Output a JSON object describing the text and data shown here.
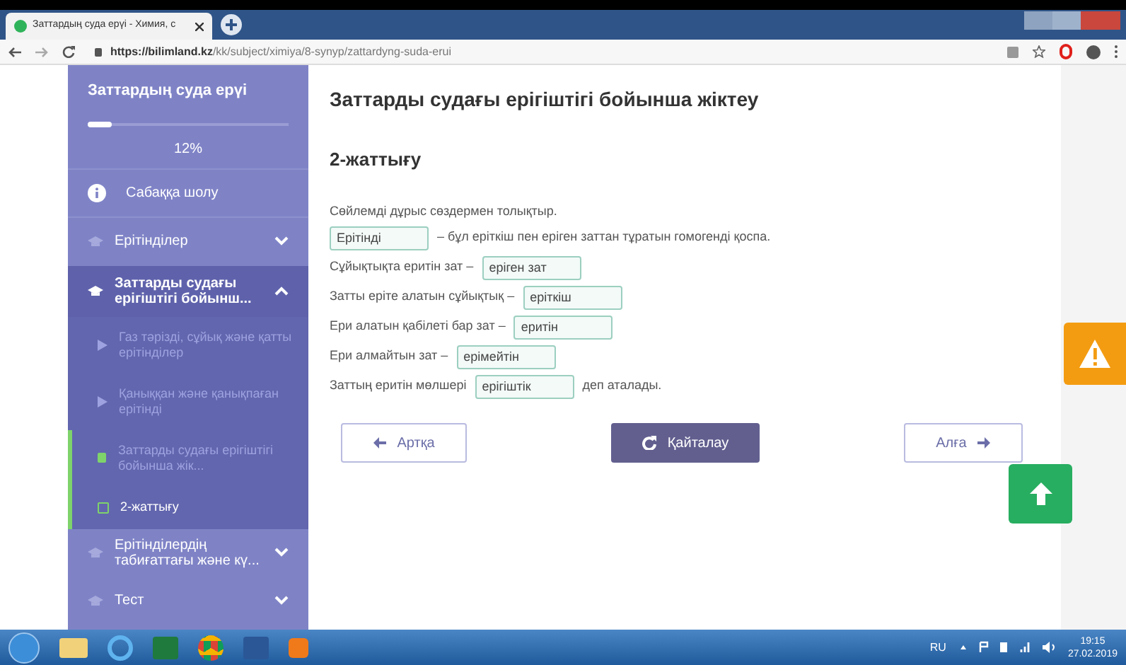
{
  "browser": {
    "tab_title": "Заттардың суда ерүі - Химия, с",
    "url_host": "https://bilimland.kz",
    "url_path": "/kk/subject/ximiya/8-synyp/zattardyng-suda-erui"
  },
  "sidebar": {
    "title": "Заттардың суда ерүі",
    "progress": {
      "level": 0.12,
      "reading": "12%"
    },
    "items": [
      {
        "kind": "overview",
        "label": "Сабаққа шолу"
      },
      {
        "kind": "section",
        "label": "Ерітінділер",
        "expanded": false
      },
      {
        "kind": "section",
        "label": "Заттарды судағы ерігіштігі бойынш...",
        "expanded": true,
        "children": [
          {
            "kind": "video",
            "label": "Газ тәрізді, сұйық және қатты ерітінділер",
            "selected": false
          },
          {
            "kind": "video",
            "label": "Қаныққан және қанықпаған ерітінді",
            "selected": false
          },
          {
            "kind": "reading",
            "label": "Заттарды судағы ерігіштігі бойынша жік...",
            "selected": false
          },
          {
            "kind": "exercise",
            "label": "2-жаттығу",
            "selected": true
          }
        ]
      },
      {
        "kind": "section",
        "label": "Ерітінділердің табиғаттағы және кү...",
        "expanded": false
      },
      {
        "kind": "section",
        "label": "Тест",
        "expanded": false
      }
    ]
  },
  "main": {
    "heading": "Заттарды судағы ерігіштігі бойынша жіктеу",
    "subheading": "2-жаттығу",
    "instruction": "Сөйлемді дұрыс сөздермен толықтыр.",
    "sentences": [
      [
        {
          "kind": "field",
          "value": "Ерітінді"
        },
        {
          "kind": "text",
          "text": "– бұл еріткіш пен еріген заттан тұратын гомогенді қоспа."
        }
      ],
      [
        {
          "kind": "text",
          "text": "Сұйықтықта еритін зат –"
        },
        {
          "kind": "field",
          "value": "еріген зат"
        }
      ],
      [
        {
          "kind": "text",
          "text": "Затты еріте алатын сұйықтық –"
        },
        {
          "kind": "field",
          "value": "еріткіш"
        }
      ],
      [
        {
          "kind": "text",
          "text": "Ери алатын қабілеті бар зат –"
        },
        {
          "kind": "field",
          "value": "еритін"
        }
      ],
      [
        {
          "kind": "text",
          "text": "Ери алмайтын зат –"
        },
        {
          "kind": "field",
          "value": "ерімейтін"
        }
      ],
      [
        {
          "kind": "text",
          "text": "Заттың еритін мөлшері"
        },
        {
          "kind": "field",
          "value": "ерігіштік"
        },
        {
          "kind": "text",
          "text": "деп аталады."
        }
      ]
    ],
    "buttons": {
      "back": "Артқа",
      "retry": "Қайталау",
      "next": "Алға"
    }
  },
  "taskbar": {
    "language": "RU",
    "time": "19:15",
    "date": "27.02.2019"
  }
}
